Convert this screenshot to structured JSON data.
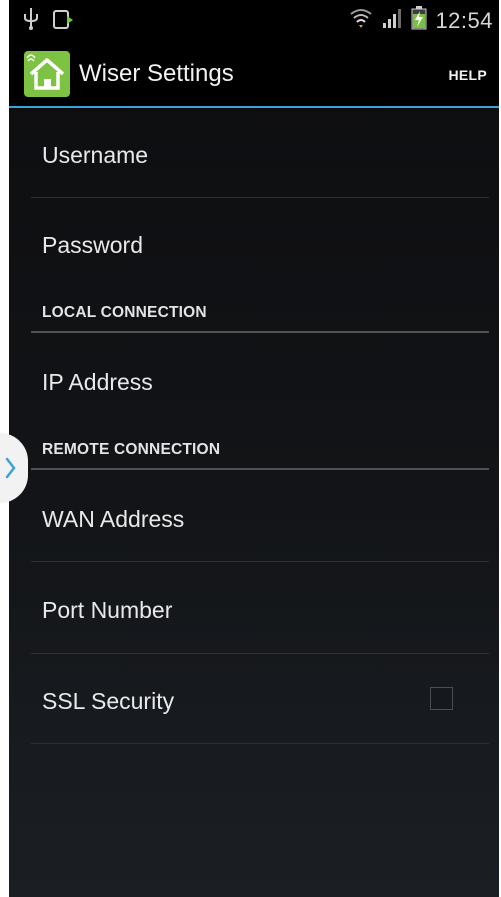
{
  "status_bar": {
    "time": "12:54",
    "left_icons": [
      "usb-icon",
      "download-notification-icon"
    ],
    "right_icons": [
      "wifi-icon",
      "signal-icon",
      "battery-charging-icon"
    ]
  },
  "action_bar": {
    "title": "Wiser Settings",
    "help_label": "HELP",
    "accent_color": "#3aa3d6",
    "app_icon_color": "#7dc242"
  },
  "settings": {
    "username_label": "Username",
    "password_label": "Password",
    "local_section_title": "LOCAL CONNECTION",
    "ip_address_label": "IP Address",
    "remote_section_title": "REMOTE CONNECTION",
    "wan_address_label": "WAN Address",
    "port_number_label": "Port Number",
    "ssl_security_label": "SSL Security",
    "ssl_checked": false
  }
}
